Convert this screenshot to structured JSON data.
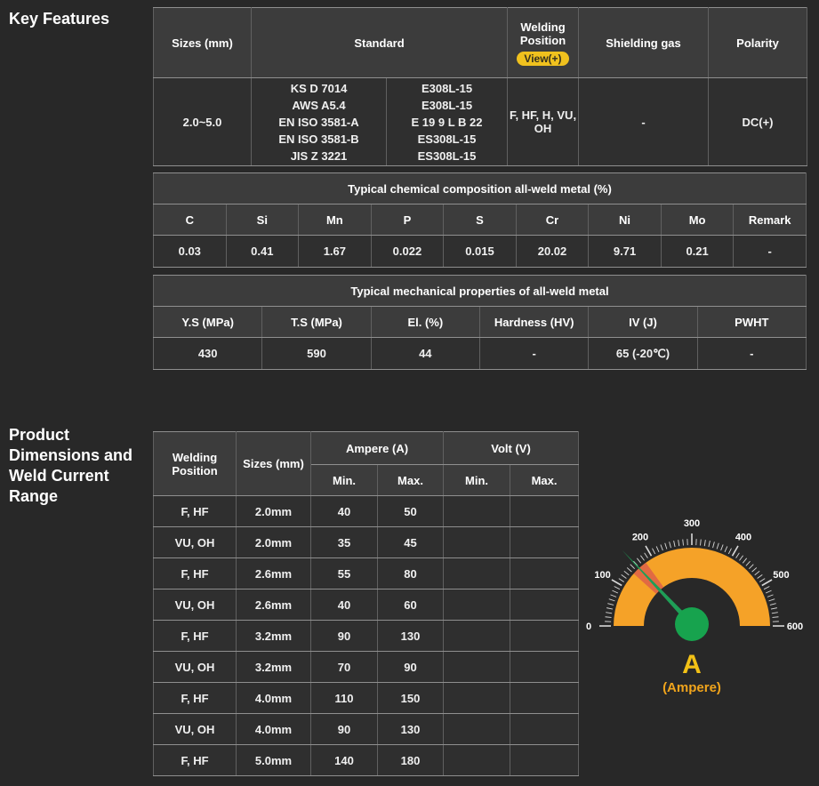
{
  "headings": {
    "key_features": "Key Features",
    "product_dimensions": "Product Dimensions and Weld Current Range"
  },
  "key_features_table": {
    "col_sizes": "Sizes (mm)",
    "col_standard": "Standard",
    "col_welding_position": "Welding Position",
    "view_badge": "View(+)",
    "col_shielding_gas": "Shielding gas",
    "col_polarity": "Polarity",
    "row": {
      "sizes": "2.0~5.0",
      "standard_systems": "KS D 7014\nAWS A5.4\nEN ISO 3581-A\nEN ISO 3581-B\nJIS Z 3221",
      "standard_grades": "E308L-15\nE308L-15\nE 19 9 L B 22\nES308L-15\nES308L-15",
      "welding_position": "F, HF, H, VU, OH",
      "shielding_gas": "-",
      "polarity": "DC(+)"
    }
  },
  "chemical_table": {
    "title": "Typical chemical composition all-weld metal (%)",
    "headers": [
      "C",
      "Si",
      "Mn",
      "P",
      "S",
      "Cr",
      "Ni",
      "Mo",
      "Remark"
    ],
    "values": [
      "0.03",
      "0.41",
      "1.67",
      "0.022",
      "0.015",
      "20.02",
      "9.71",
      "0.21",
      "-"
    ]
  },
  "mechanical_table": {
    "title": "Typical mechanical properties of all-weld metal",
    "headers": [
      "Y.S (MPa)",
      "T.S (MPa)",
      "El. (%)",
      "Hardness (HV)",
      "IV (J)",
      "PWHT"
    ],
    "values": [
      "430",
      "590",
      "44",
      "-",
      "65 (-20℃)",
      "-"
    ]
  },
  "current_table": {
    "col_welding_position": "Welding Position",
    "col_sizes": "Sizes (mm)",
    "col_ampere": "Ampere (A)",
    "col_volt": "Volt (V)",
    "col_min": "Min.",
    "col_max": "Max.",
    "rows": [
      {
        "pos": "F, HF",
        "size": "2.0mm",
        "amp_min": "40",
        "amp_max": "50",
        "volt_min": "",
        "volt_max": ""
      },
      {
        "pos": "VU, OH",
        "size": "2.0mm",
        "amp_min": "35",
        "amp_max": "45",
        "volt_min": "",
        "volt_max": ""
      },
      {
        "pos": "F, HF",
        "size": "2.6mm",
        "amp_min": "55",
        "amp_max": "80",
        "volt_min": "",
        "volt_max": ""
      },
      {
        "pos": "VU, OH",
        "size": "2.6mm",
        "amp_min": "40",
        "amp_max": "60",
        "volt_min": "",
        "volt_max": ""
      },
      {
        "pos": "F, HF",
        "size": "3.2mm",
        "amp_min": "90",
        "amp_max": "130",
        "volt_min": "",
        "volt_max": ""
      },
      {
        "pos": "VU, OH",
        "size": "3.2mm",
        "amp_min": "70",
        "amp_max": "90",
        "volt_min": "",
        "volt_max": ""
      },
      {
        "pos": "F, HF",
        "size": "4.0mm",
        "amp_min": "110",
        "amp_max": "150",
        "volt_min": "",
        "volt_max": ""
      },
      {
        "pos": "VU, OH",
        "size": "4.0mm",
        "amp_min": "90",
        "amp_max": "130",
        "volt_min": "",
        "volt_max": ""
      },
      {
        "pos": "F, HF",
        "size": "5.0mm",
        "amp_min": "140",
        "amp_max": "180",
        "volt_min": "",
        "volt_max": ""
      }
    ]
  },
  "gauge": {
    "type": "gauge",
    "unit_label": "A",
    "unit_sub": "(Ampere)",
    "min": 0,
    "max": 600,
    "minor_step": 10,
    "major_step": 100,
    "major_ticks": [
      0,
      100,
      200,
      300,
      400,
      500,
      600
    ],
    "needle_value": 158,
    "highlight_range": [
      140,
      180
    ],
    "colors": {
      "band": "#F5A228",
      "highlight": "#D9534F",
      "needle": "#1F9E57",
      "hub": "#17A34E",
      "tick": "#D8D8D8",
      "label": "#FFFFFF"
    }
  },
  "colors": {
    "page_bg": "#282828",
    "header_bg": "#3C3C3C",
    "cell_bg": "#2F2F2F",
    "accent_yellow": "#F2B31C",
    "badge_bg": "#F0C11E"
  }
}
